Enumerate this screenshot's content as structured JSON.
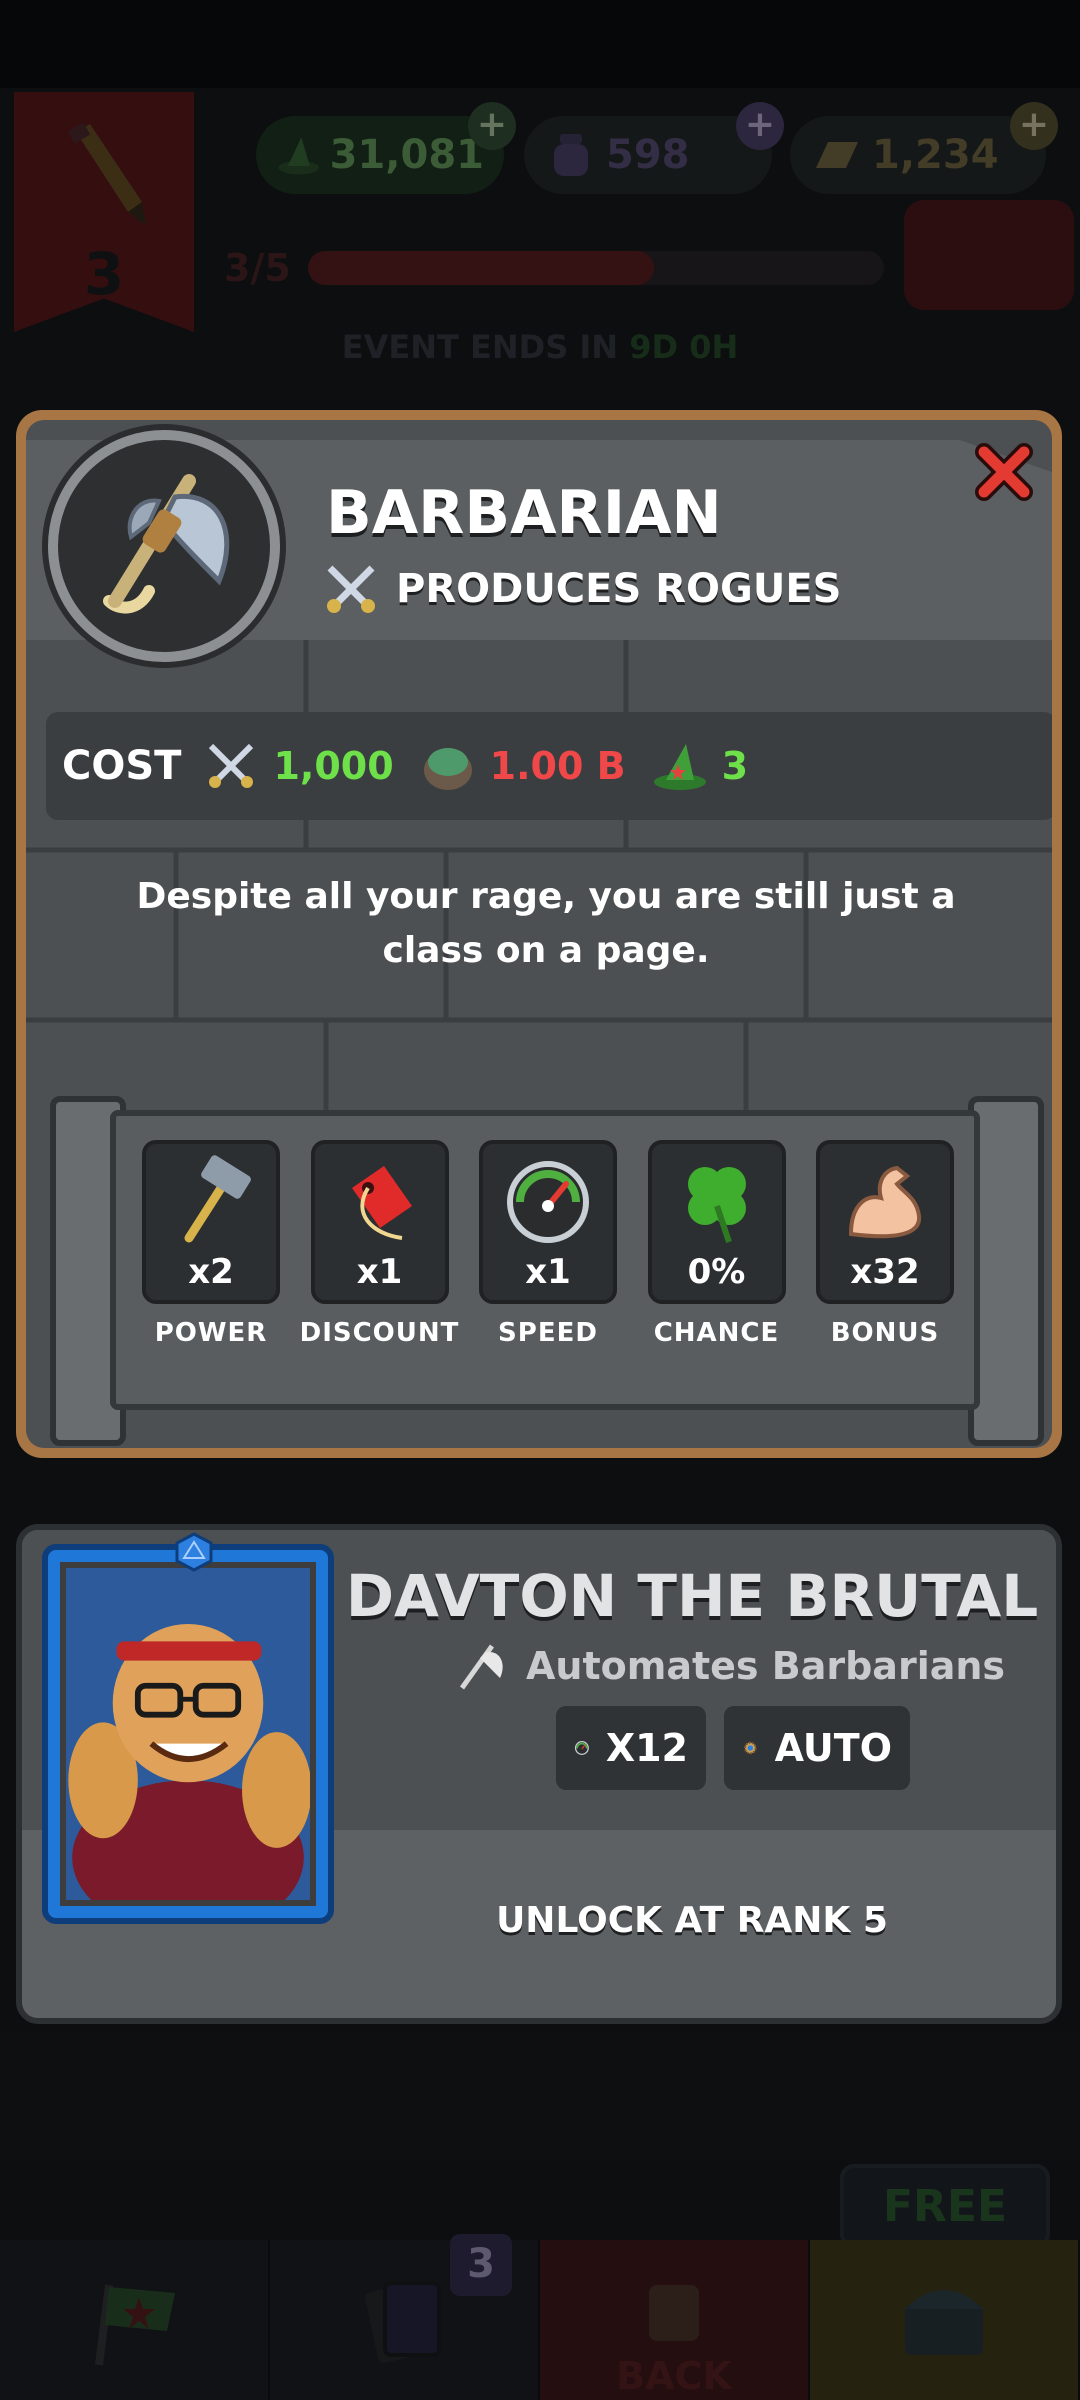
{
  "background": {
    "rank": "3",
    "resources": {
      "green": "31,081",
      "purple": "598",
      "gold": "1,234"
    },
    "rank_progress": {
      "label": "3/5",
      "fraction": 0.6
    },
    "event": {
      "prefix": "EVENT ENDS IN",
      "time": "9D 0H"
    },
    "free_label": "FREE",
    "nav": {
      "cards_count": "3",
      "back_label": "BACK"
    }
  },
  "modal": {
    "title": "BARBARIAN",
    "produces": "PRODUCES ROGUES",
    "cost": {
      "label": "COST",
      "rogues": "1,000",
      "ore": "1.00 B",
      "wizards": "3"
    },
    "flavor_text": "Despite all your rage, you are still just a class on a page.",
    "stats": [
      {
        "icon": "hammer-icon",
        "value": "x2",
        "label": "POWER"
      },
      {
        "icon": "price-tag-icon",
        "value": "x1",
        "label": "DISCOUNT"
      },
      {
        "icon": "speedometer-icon",
        "value": "x1",
        "label": "SPEED"
      },
      {
        "icon": "clover-icon",
        "value": "0%",
        "label": "CHANCE"
      },
      {
        "icon": "flexed-arm-icon",
        "value": "x32",
        "label": "BONUS"
      }
    ]
  },
  "manager": {
    "name": "DAVTON THE BRUTAL",
    "automates": "Automates Barbarians",
    "speed_multiplier": "X12",
    "auto_label": "AUTO",
    "unlock_text": "UNLOCK AT RANK 5"
  },
  "colors": {
    "cost_green": "#6de04a",
    "cost_red": "#f04848",
    "frame_blue": "#1f78d8",
    "wood": "#a87545"
  }
}
